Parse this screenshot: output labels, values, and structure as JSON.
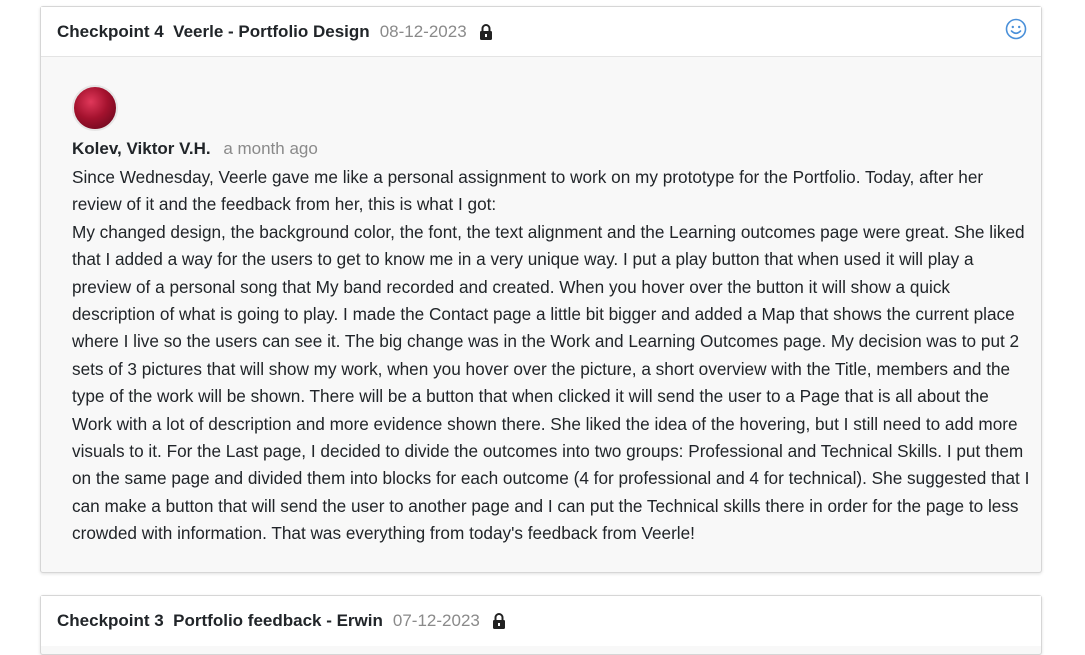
{
  "checkpoints": [
    {
      "title": "Checkpoint 4  Veerle - Portfolio Design",
      "date": "08-12-2023",
      "comment": {
        "author": "Kolev, Viktor V.H.",
        "time_ago": "a month ago",
        "paragraphs": [
          "Since Wednesday, Veerle gave me like a personal assignment to work on my prototype for the Portfolio. Today, after her review of it and the feedback from her, this is what I got:",
          "My changed design, the background color, the font, the text alignment and the Learning outcomes page were great. She liked that I added a way for the users to get to know me in a very unique way. I put a play button that when used it will play a preview of a personal song that My band recorded and created. When you hover over the button it will show a quick description of what is going to play. I made the Contact page a little bit bigger and added a Map that shows the current place where I live so the users can see it. The big change was in the Work and Learning Outcomes page. My decision was to put 2 sets of 3 pictures that will show my work, when you hover over the picture, a short overview with the Title, members and the type of the work will be shown. There will be a button that when clicked it will send the user to a Page that is all about the Work with a lot of description and more evidence shown there. She liked the idea of the hovering, but I still need to add more visuals to it. For the Last page, I decided to divide the outcomes into two groups: Professional and Technical Skills. I put them on the same page and divided them into blocks for each outcome (4 for professional and 4 for technical). She suggested that I can make a button that will send the user to another page and I can put the Technical skills there in order for the page to less crowded with information. That was everything from today's feedback from Veerle!"
        ]
      }
    },
    {
      "title": "Checkpoint 3  Portfolio feedback - Erwin",
      "date": "07-12-2023"
    }
  ],
  "icons": {
    "lock": "lock-icon",
    "reaction": "smiley-icon"
  },
  "colors": {
    "accent": "#4a90d9",
    "muted": "#8a8a8a",
    "text": "#212529"
  }
}
